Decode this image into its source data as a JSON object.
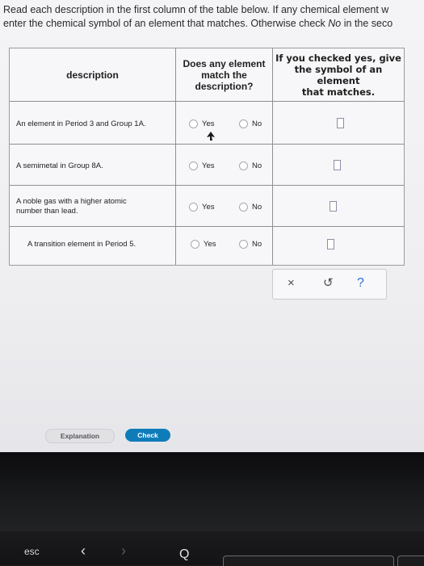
{
  "instructions": {
    "line1": "Read each description in the first column of the table below. If any chemical element w",
    "line2_a": "enter the chemical symbol of an element that matches. Otherwise check ",
    "line2_no": "No",
    "line2_b": " in the seco"
  },
  "table": {
    "headers": {
      "description": "description",
      "match_line1": "Does any element",
      "match_line2": "match the",
      "match_line3": "description?",
      "symbol_line1": "If you checked yes, give",
      "symbol_line2": "the symbol of an",
      "symbol_line3": "element",
      "symbol_line4": "that matches."
    },
    "rows": [
      {
        "description": "An element in Period 3 and Group 1A.",
        "yes": "Yes",
        "no": "No",
        "symbol": ""
      },
      {
        "description": "A semimetal in Group 8A.",
        "yes": "Yes",
        "no": "No",
        "symbol": ""
      },
      {
        "description_line1": "A noble gas with a higher atomic",
        "description_line2": "number than lead.",
        "yes": "Yes",
        "no": "No",
        "symbol": ""
      },
      {
        "description": "A transition element in Period 5.",
        "yes": "Yes",
        "no": "No",
        "symbol": ""
      }
    ]
  },
  "toolbar": {
    "clear": "×",
    "undo": "↺",
    "help": "?"
  },
  "buttons": {
    "explanation": "Explanation",
    "check": "Check"
  },
  "keyboard": {
    "esc": "esc",
    "back": "‹",
    "forward": "›",
    "search": "Q"
  },
  "colors": {
    "check_button": "#0f7cba",
    "help_icon": "#2a6fd6"
  }
}
